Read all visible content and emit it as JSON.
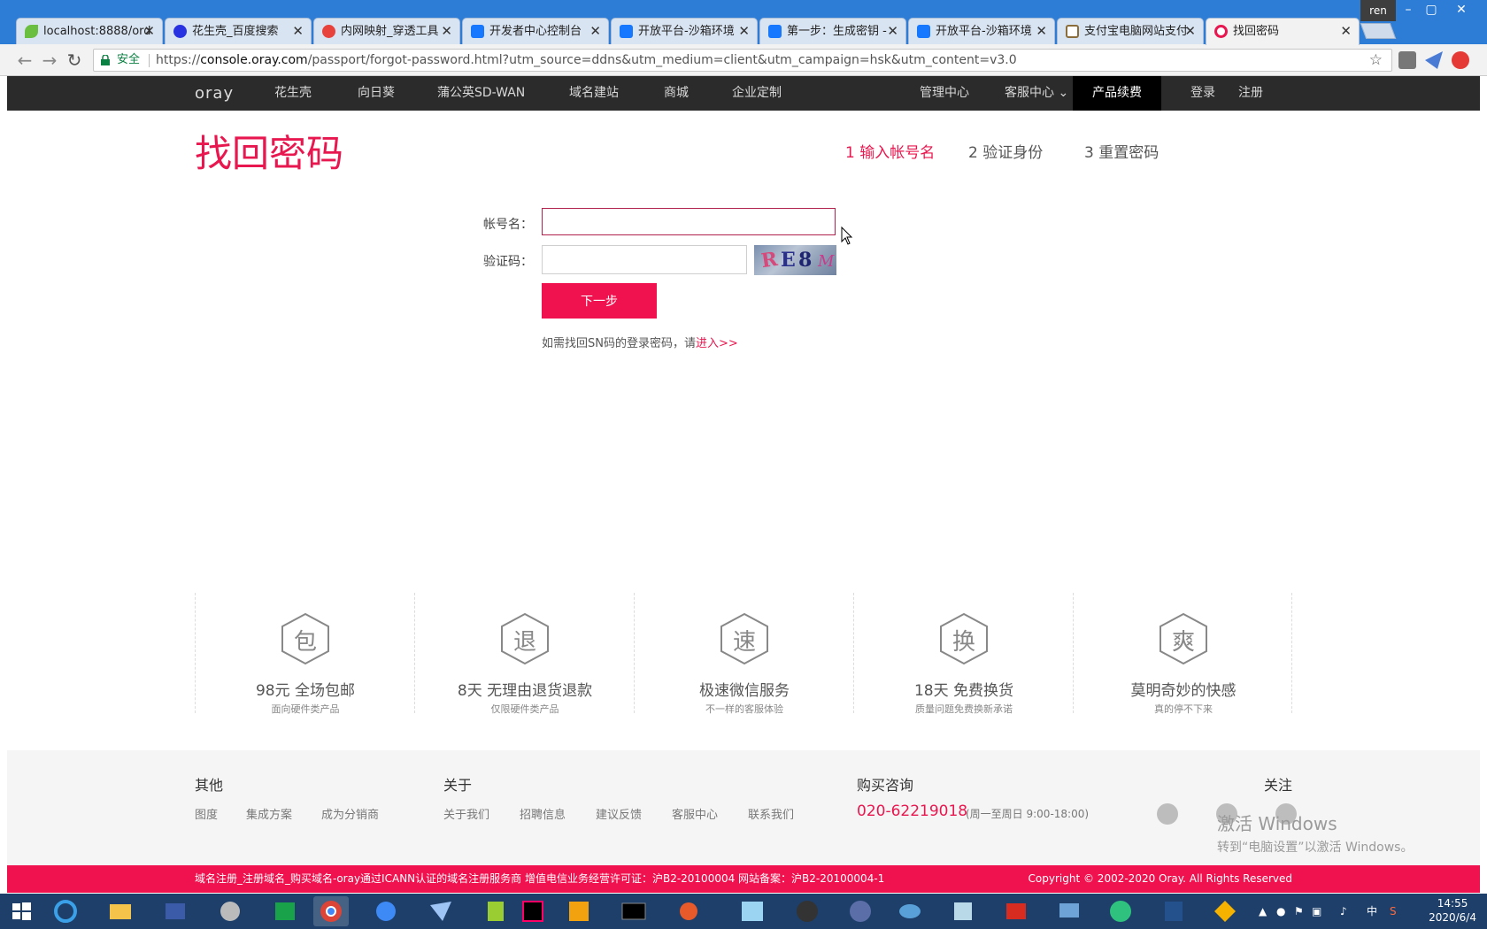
{
  "window": {
    "profile_name": "ren",
    "tabs": [
      {
        "title": "localhost:8888/ord",
        "icon": "leaf-icon",
        "color": "#6abf40"
      },
      {
        "title": "花生壳_百度搜索",
        "icon": "baidu-paw-icon",
        "color": "#2932e1"
      },
      {
        "title": "内网映射_穿透工具",
        "icon": "shell-icon",
        "color": "#e8423d"
      },
      {
        "title": "开发者中心控制台",
        "icon": "alipay-icon",
        "color": "#1677ff"
      },
      {
        "title": "开放平台-沙箱环境",
        "icon": "alipay-icon",
        "color": "#1677ff"
      },
      {
        "title": "第一步：生成密钥 -",
        "icon": "alipay-icon",
        "color": "#1677ff"
      },
      {
        "title": "开放平台-沙箱环境",
        "icon": "alipay-icon",
        "color": "#1677ff"
      },
      {
        "title": "支付宝电脑网站支付",
        "icon": "doc-icon",
        "color": "#8a6d3b"
      },
      {
        "title": "找回密码",
        "icon": "oray-icon",
        "color": "#e8174f"
      }
    ]
  },
  "address_bar": {
    "secure_label": "安全",
    "url_scheme": "https://",
    "url_host": "console.oray.com",
    "url_rest": "/passport/forgot-password.html?utm_source=ddns&utm_medium=client&utm_campaign=hsk&utm_content=v3.0"
  },
  "navbar": {
    "logo": "oray",
    "left_items": [
      "花生壳",
      "向日葵",
      "蒲公英SD-WAN",
      "域名建站",
      "商城",
      "企业定制"
    ],
    "management": "管理中心",
    "support": "客服中心",
    "renew": "产品续费",
    "login": "登录",
    "register": "注册"
  },
  "page": {
    "title": "找回密码",
    "steps": [
      "1 输入帐号名",
      "2 验证身份",
      "3 重置密码"
    ],
    "account_label": "帐号名：",
    "account_value": "",
    "captcha_label": "验证码：",
    "captcha_value": "",
    "captcha_chars": [
      "R",
      "E",
      "8",
      "M"
    ],
    "next_button": "下一步",
    "sn_hint": "如需找回SN码的登录密码，请",
    "sn_link": "进入>>"
  },
  "services": [
    {
      "char": "包",
      "title": "98元 全场包邮",
      "subtitle": "面向硬件类产品"
    },
    {
      "char": "退",
      "title": "8天 无理由退货退款",
      "subtitle": "仅限硬件类产品"
    },
    {
      "char": "速",
      "title": "极速微信服务",
      "subtitle": "不一样的客服体验"
    },
    {
      "char": "换",
      "title": "18天 免费换货",
      "subtitle": "质量问题免费换新承诺"
    },
    {
      "char": "爽",
      "title": "莫明奇妙的快感",
      "subtitle": "真的停不下来"
    }
  ],
  "footer": {
    "other_title": "其他",
    "other_links": [
      "图度",
      "集成方案",
      "成为分销商"
    ],
    "about_title": "关于",
    "about_links": [
      "关于我们",
      "招聘信息",
      "建议反馈",
      "客服中心",
      "联系我们"
    ],
    "consult_title": "购买咨询",
    "phone": "020-62219018",
    "hours": "(周一至周日 9:00-18:00)",
    "follow_title": "关注",
    "activate_title": "激活 Windows",
    "activate_sub": "转到“电脑设置”以激活 Windows。",
    "legal_left": "域名注册_注册域名_购买域名-oray通过ICANN认证的域名注册服务商  增值电信业务经营许可证：沪B2-20100004 网站备案：沪B2-20100004-1",
    "copyright": "Copyright © 2002-2020 Oray. All Rights Reserved"
  },
  "taskbar": {
    "ime": "中",
    "time": "14:55",
    "date": "2020/6/4"
  },
  "colors": {
    "brand": "#e8174f",
    "nav_bg": "#2b2b2b",
    "chrome_frame": "#2d7cd6",
    "taskbar": "#1d3f6a"
  }
}
